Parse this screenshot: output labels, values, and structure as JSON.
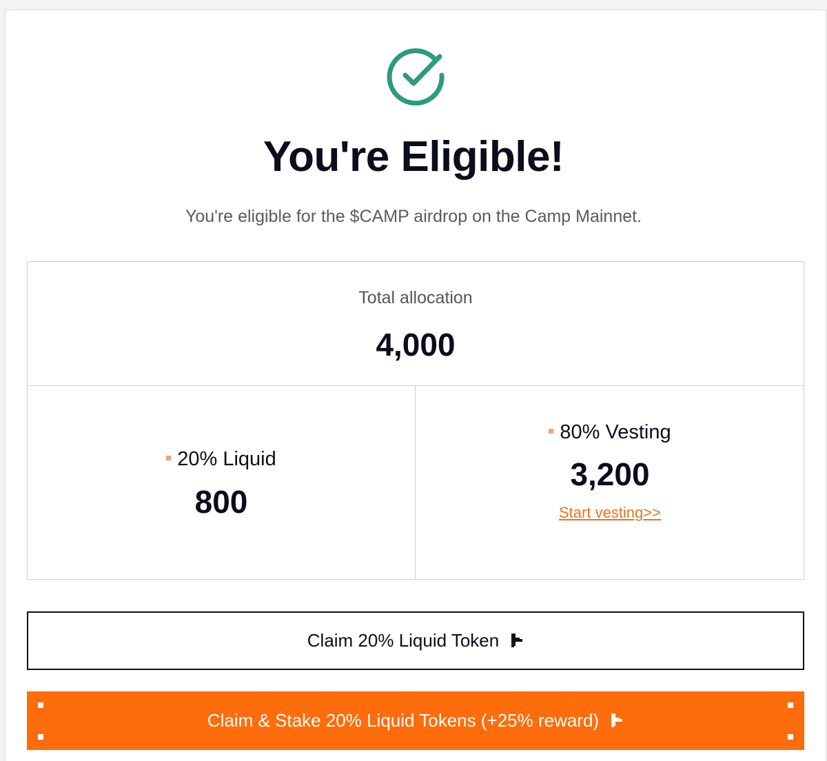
{
  "header": {
    "title": "You're Eligible!",
    "subtitle": "You're eligible for the $CAMP airdrop on the Camp Mainnet.",
    "icon": "check-circle-icon",
    "icon_color": "#2e9a7e"
  },
  "allocation": {
    "total_label": "Total allocation",
    "total_value": "4,000",
    "liquid": {
      "label": "20% Liquid",
      "value": "800"
    },
    "vesting": {
      "label": "80% Vesting",
      "value": "3,200",
      "link_text": "Start vesting>>"
    },
    "bullet_color": "#f4a071"
  },
  "actions": {
    "claim_label": "Claim 20% Liquid Token",
    "claim_stake_label": "Claim & Stake 20% Liquid Tokens (+25% reward)",
    "accent_color": "#ff6c0b",
    "link_color": "#e8741e"
  }
}
